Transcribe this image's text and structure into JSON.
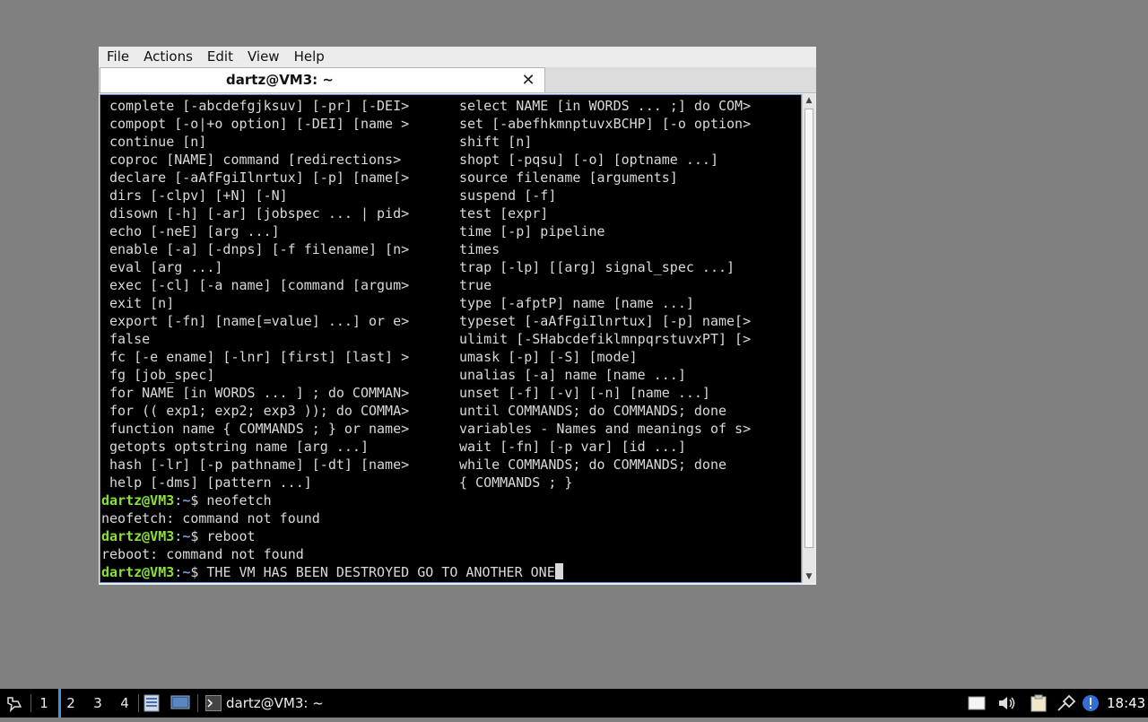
{
  "menubar": {
    "items": [
      "File",
      "Actions",
      "Edit",
      "View",
      "Help"
    ]
  },
  "tab": {
    "title": "dartz@VM3: ~",
    "close_glyph": "✕"
  },
  "terminal": {
    "help_columns": [
      [
        "complete [-abcdefgjksuv] [-pr] [-DEI>",
        "select NAME [in WORDS ... ;] do COM>"
      ],
      [
        "compopt [-o|+o option] [-DEI] [name >",
        "set [-abefhkmnptuvxBCHP] [-o option>"
      ],
      [
        "continue [n]",
        "shift [n]"
      ],
      [
        "coproc [NAME] command [redirections>",
        "shopt [-pqsu] [-o] [optname ...]"
      ],
      [
        "declare [-aAfFgiIlnrtux] [-p] [name[>",
        "source filename [arguments]"
      ],
      [
        "dirs [-clpv] [+N] [-N]",
        "suspend [-f]"
      ],
      [
        "disown [-h] [-ar] [jobspec ... | pid>",
        "test [expr]"
      ],
      [
        "echo [-neE] [arg ...]",
        "time [-p] pipeline"
      ],
      [
        "enable [-a] [-dnps] [-f filename] [n>",
        "times"
      ],
      [
        "eval [arg ...]",
        "trap [-lp] [[arg] signal_spec ...]"
      ],
      [
        "exec [-cl] [-a name] [command [argum>",
        "true"
      ],
      [
        "exit [n]",
        "type [-afptP] name [name ...]"
      ],
      [
        "export [-fn] [name[=value] ...] or e>",
        "typeset [-aAfFgiIlnrtux] [-p] name[>"
      ],
      [
        "false",
        "ulimit [-SHabcdefiklmnpqrstuvxPT] [>"
      ],
      [
        "fc [-e ename] [-lnr] [first] [last] >",
        "umask [-p] [-S] [mode]"
      ],
      [
        "fg [job_spec]",
        "unalias [-a] name [name ...]"
      ],
      [
        "for NAME [in WORDS ... ] ; do COMMAN>",
        "unset [-f] [-v] [-n] [name ...]"
      ],
      [
        "for (( exp1; exp2; exp3 )); do COMMA>",
        "until COMMANDS; do COMMANDS; done"
      ],
      [
        "function name { COMMANDS ; } or name>",
        "variables - Names and meanings of s>"
      ],
      [
        "getopts optstring name [arg ...]",
        "wait [-fn] [-p var] [id ...]"
      ],
      [
        "hash [-lr] [-p pathname] [-dt] [name>",
        "while COMMANDS; do COMMANDS; done"
      ],
      [
        "help [-dms] [pattern ...]",
        "{ COMMANDS ; }"
      ]
    ],
    "prompt_user": "dartz@VM3",
    "prompt_sep": ":",
    "prompt_path": "~",
    "prompt_sigil": "$ ",
    "cmd1": "neofetch",
    "out1": "neofetch: command not found",
    "cmd2": "reboot",
    "out2": "reboot: command not found",
    "cmd3": "THE VM HAS BEEN DESTROYED GO TO ANOTHER ONE"
  },
  "taskbar": {
    "workspaces": [
      "1",
      "2",
      "3",
      "4"
    ],
    "active_workspace": "2",
    "task_label": "dartz@VM3: ~",
    "clock": "18:43",
    "colors": {
      "prompt_user": "#8ae234",
      "prompt_path": "#729fcf",
      "active_ws_marker": "#4a90d9"
    }
  }
}
